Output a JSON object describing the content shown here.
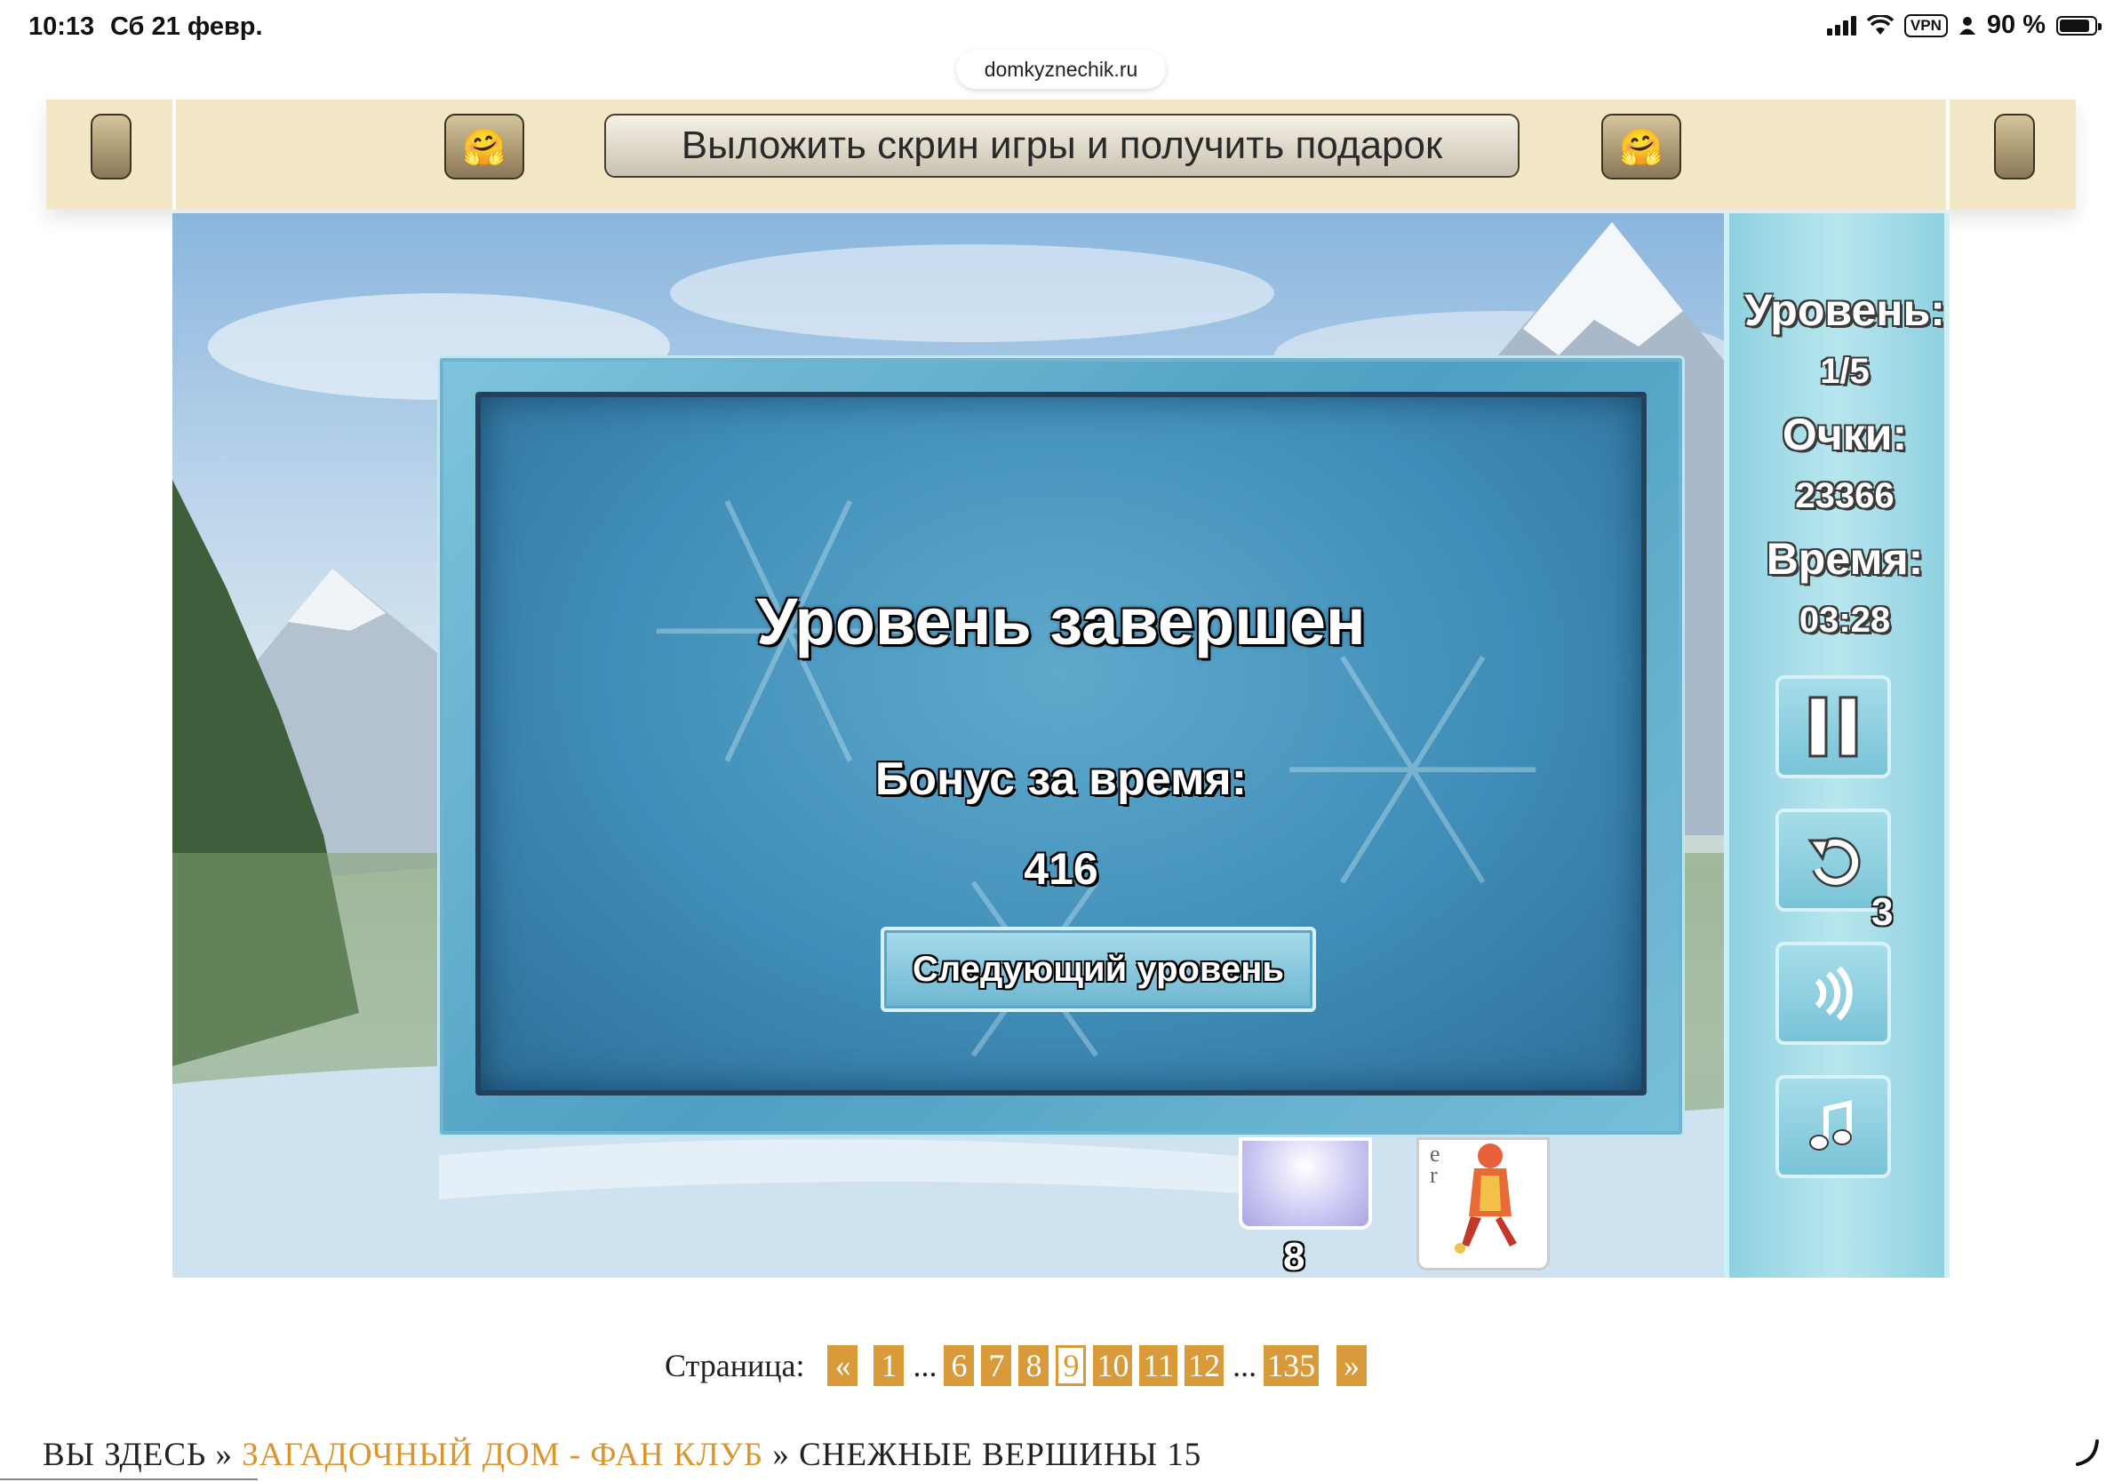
{
  "status_bar": {
    "time": "10:13",
    "date": "Сб 21 февр.",
    "vpn": "VPN",
    "battery": "90 %",
    "battery_level": 0.9
  },
  "browser": {
    "url": "domkyznechik.ru"
  },
  "banner": {
    "cta_label": "Выложить скрин игры и получить подарок",
    "emoji": "🤗"
  },
  "game": {
    "dialog": {
      "title": "Уровень завершен",
      "bonus_label": "Бонус за время:",
      "bonus_value": "416",
      "next_button": "Следующий уровень"
    },
    "side_panel": {
      "level_label": "Уровень:",
      "level_value": "1/5",
      "score_label": "Очки:",
      "score_value": "23366",
      "time_label": "Время:",
      "time_value": "03:28",
      "undo_count": "3",
      "buttons": [
        "pause-icon",
        "undo-icon",
        "sound-icon",
        "music-icon"
      ]
    },
    "stock_count": "8",
    "card_letters": "e\nr"
  },
  "pagination": {
    "label": "Страница:",
    "prev": "«",
    "next": "»",
    "ellipsis": "...",
    "pages": [
      "1",
      "6",
      "7",
      "8",
      "9",
      "10",
      "11",
      "12",
      "135"
    ],
    "current": "9"
  },
  "breadcrumb": {
    "prefix": "ВЫ ЗДЕСЬ",
    "sep": "»",
    "link": "ЗАГАДОЧНЫЙ ДОМ - ФАН КЛУБ",
    "current": "СНЕЖНЫЕ ВЕРШИНЫ 15"
  },
  "colors": {
    "banner_bg": "#f3e8c6",
    "page_accent": "#d99a3a",
    "ice_blue": "#4e9fc2"
  }
}
